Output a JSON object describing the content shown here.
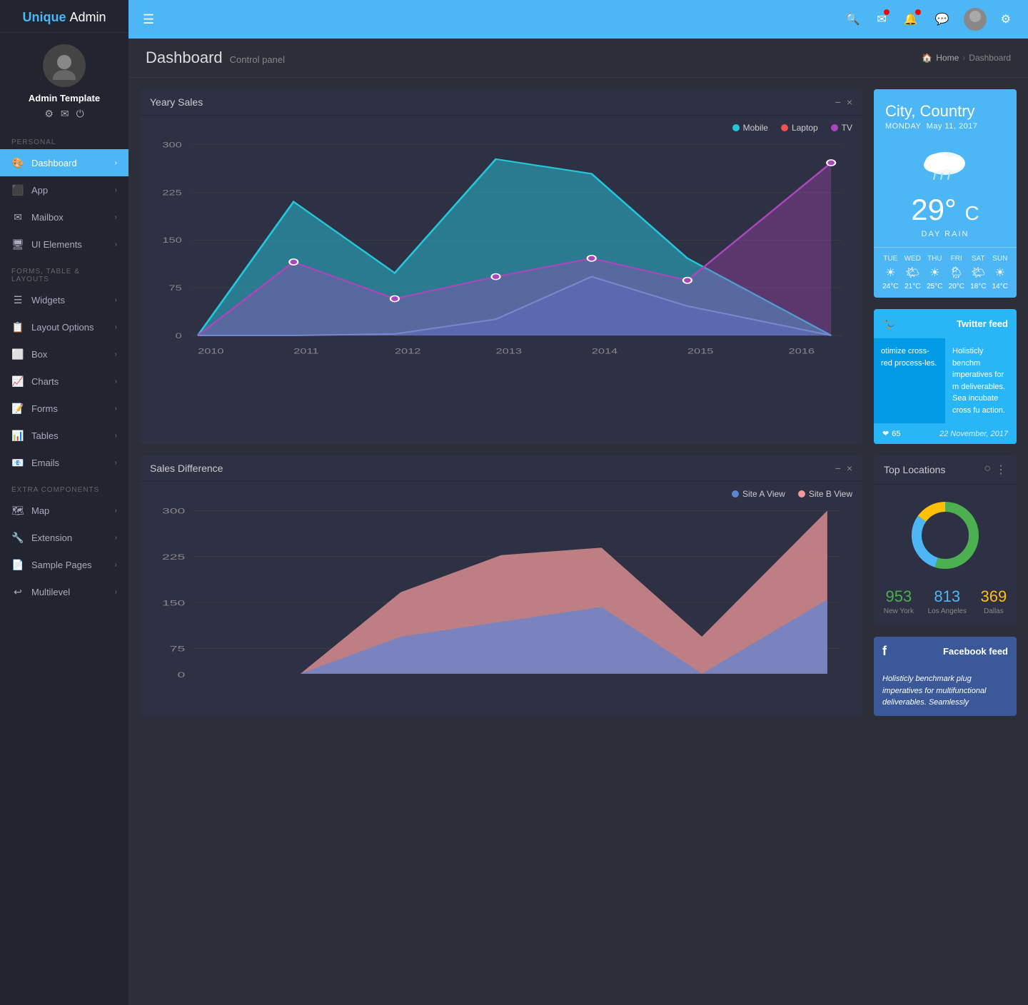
{
  "brand": {
    "unique": "Unique",
    "admin": "Admin"
  },
  "sidebar": {
    "username": "Admin Template",
    "user_icons": [
      "⚙",
      "✉",
      "⏻"
    ],
    "sections": [
      {
        "label": "PERSONAL",
        "items": [
          {
            "id": "dashboard",
            "icon": "🎨",
            "label": "Dashboard",
            "active": true,
            "has_arrow": true
          },
          {
            "id": "app",
            "icon": "⬛",
            "label": "App",
            "active": false,
            "has_arrow": true
          }
        ]
      },
      {
        "label": "",
        "items": [
          {
            "id": "mailbox",
            "icon": "✉",
            "label": "Mailbox",
            "active": false,
            "has_arrow": true
          },
          {
            "id": "ui-elements",
            "icon": "🖥",
            "label": "UI Elements",
            "active": false,
            "has_arrow": true
          }
        ]
      },
      {
        "label": "FORMS, TABLE & LAYOUTS",
        "items": [
          {
            "id": "widgets",
            "icon": "☰",
            "label": "Widgets",
            "active": false,
            "has_arrow": true
          },
          {
            "id": "layout-options",
            "icon": "📋",
            "label": "Layout Options",
            "active": false,
            "has_arrow": true
          },
          {
            "id": "box",
            "icon": "⬜",
            "label": "Box",
            "active": false,
            "has_arrow": true
          },
          {
            "id": "charts",
            "icon": "📈",
            "label": "Charts",
            "active": false,
            "has_arrow": true
          },
          {
            "id": "forms",
            "icon": "📝",
            "label": "Forms",
            "active": false,
            "has_arrow": true
          },
          {
            "id": "tables",
            "icon": "📊",
            "label": "Tables",
            "active": false,
            "has_arrow": true
          },
          {
            "id": "emails",
            "icon": "📧",
            "label": "Emails",
            "active": false,
            "has_arrow": true
          }
        ]
      },
      {
        "label": "EXTRA COMPONENTS",
        "items": [
          {
            "id": "map",
            "icon": "🗺",
            "label": "Map",
            "active": false,
            "has_arrow": true
          },
          {
            "id": "extension",
            "icon": "🔧",
            "label": "Extension",
            "active": false,
            "has_arrow": true
          },
          {
            "id": "sample-pages",
            "icon": "📄",
            "label": "Sample Pages",
            "active": false,
            "has_arrow": true
          },
          {
            "id": "multilevel",
            "icon": "↩",
            "label": "Multilevel",
            "active": false,
            "has_arrow": true
          }
        ]
      }
    ]
  },
  "topbar": {
    "menu_icon": "☰",
    "icons": [
      "🔍",
      "✉",
      "🔔",
      "💬",
      "⚙"
    ]
  },
  "page_header": {
    "title": "Dashboard",
    "subtitle": "Control panel",
    "breadcrumb": [
      "Home",
      "Dashboard"
    ]
  },
  "yearly_sales": {
    "title": "Yeary Sales",
    "legend": [
      {
        "label": "Mobile",
        "color": "#26c6da"
      },
      {
        "label": "Laptop",
        "color": "#ef5350"
      },
      {
        "label": "TV",
        "color": "#ab47bc"
      }
    ],
    "y_labels": [
      "0",
      "75",
      "150",
      "225",
      "300"
    ],
    "x_labels": [
      "2010",
      "2011",
      "2012",
      "2013",
      "2014",
      "2015",
      "2016"
    ]
  },
  "weather": {
    "city": "City,",
    "country": "Country",
    "day": "MONDAY",
    "date": "May 11, 2017",
    "temp": "29°",
    "unit": "C",
    "desc": "DAY RAIN",
    "forecast": [
      {
        "day": "TUE",
        "icon": "☀",
        "temp": "24°C"
      },
      {
        "day": "WED",
        "icon": "🌤",
        "temp": "21°C"
      },
      {
        "day": "THU",
        "icon": "☀",
        "temp": "25°C"
      },
      {
        "day": "FRI",
        "icon": "🌦",
        "temp": "20°C"
      },
      {
        "day": "SAT",
        "icon": "🌤",
        "temp": "18°C"
      },
      {
        "day": "SUN",
        "icon": "☀",
        "temp": "14°C"
      }
    ]
  },
  "twitter": {
    "title": "Twitter feed",
    "col1": "otimize cross-red process-les.",
    "col2": "Holisticly benchm imperatives for m deliverables. Sea incubate cross fu action.",
    "likes": "65",
    "date": "22 November, 2017"
  },
  "sales_diff": {
    "title": "Sales Difference",
    "legend": [
      {
        "label": "Site A View",
        "color": "#5c85d6"
      },
      {
        "label": "Site B View",
        "color": "#ef9a9a"
      }
    ],
    "y_labels": [
      "0",
      "75",
      "150",
      "225",
      "300"
    ]
  },
  "top_locations": {
    "title": "Top Locations",
    "stats": [
      {
        "value": "953",
        "city": "New York",
        "color": "green"
      },
      {
        "value": "813",
        "city": "Los Angeles",
        "color": "blue"
      },
      {
        "value": "369",
        "city": "Dallas",
        "color": "yellow"
      }
    ]
  },
  "facebook": {
    "title": "Facebook feed",
    "body": "Holisticly benchmark plug imperatives for multifunctional deliverables. Seamlessly"
  }
}
